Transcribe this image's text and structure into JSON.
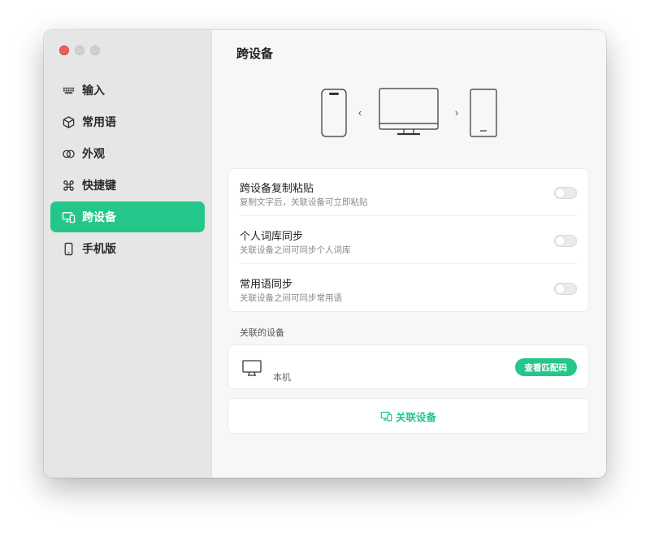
{
  "sidebar": {
    "items": [
      {
        "label": "输入",
        "icon": "keyboard-icon",
        "active": false
      },
      {
        "label": "常用语",
        "icon": "cube-icon",
        "active": false
      },
      {
        "label": "外观",
        "icon": "circles-icon",
        "active": false
      },
      {
        "label": "快捷键",
        "icon": "command-icon",
        "active": false
      },
      {
        "label": "跨设备",
        "icon": "devices-icon",
        "active": true
      },
      {
        "label": "手机版",
        "icon": "phone-icon",
        "active": false
      }
    ]
  },
  "main": {
    "title": "跨设备",
    "illustration": {
      "left_arrow": "‹",
      "right_arrow": "›"
    },
    "settings": [
      {
        "title": "跨设备复制粘贴",
        "subtitle": "复制文字后，关联设备可立即粘贴",
        "enabled": false
      },
      {
        "title": "个人词库同步",
        "subtitle": "关联设备之间可同步个人词库",
        "enabled": false
      },
      {
        "title": "常用语同步",
        "subtitle": "关联设备之间可同步常用语",
        "enabled": false
      }
    ],
    "linked_section_label": "关联的设备",
    "device": {
      "name": "本机",
      "icon": "monitor-icon",
      "pair_button": "查看匹配码"
    },
    "link_button": "关联设备"
  },
  "colors": {
    "accent": "#25c68a",
    "close": "#ec5f56"
  }
}
